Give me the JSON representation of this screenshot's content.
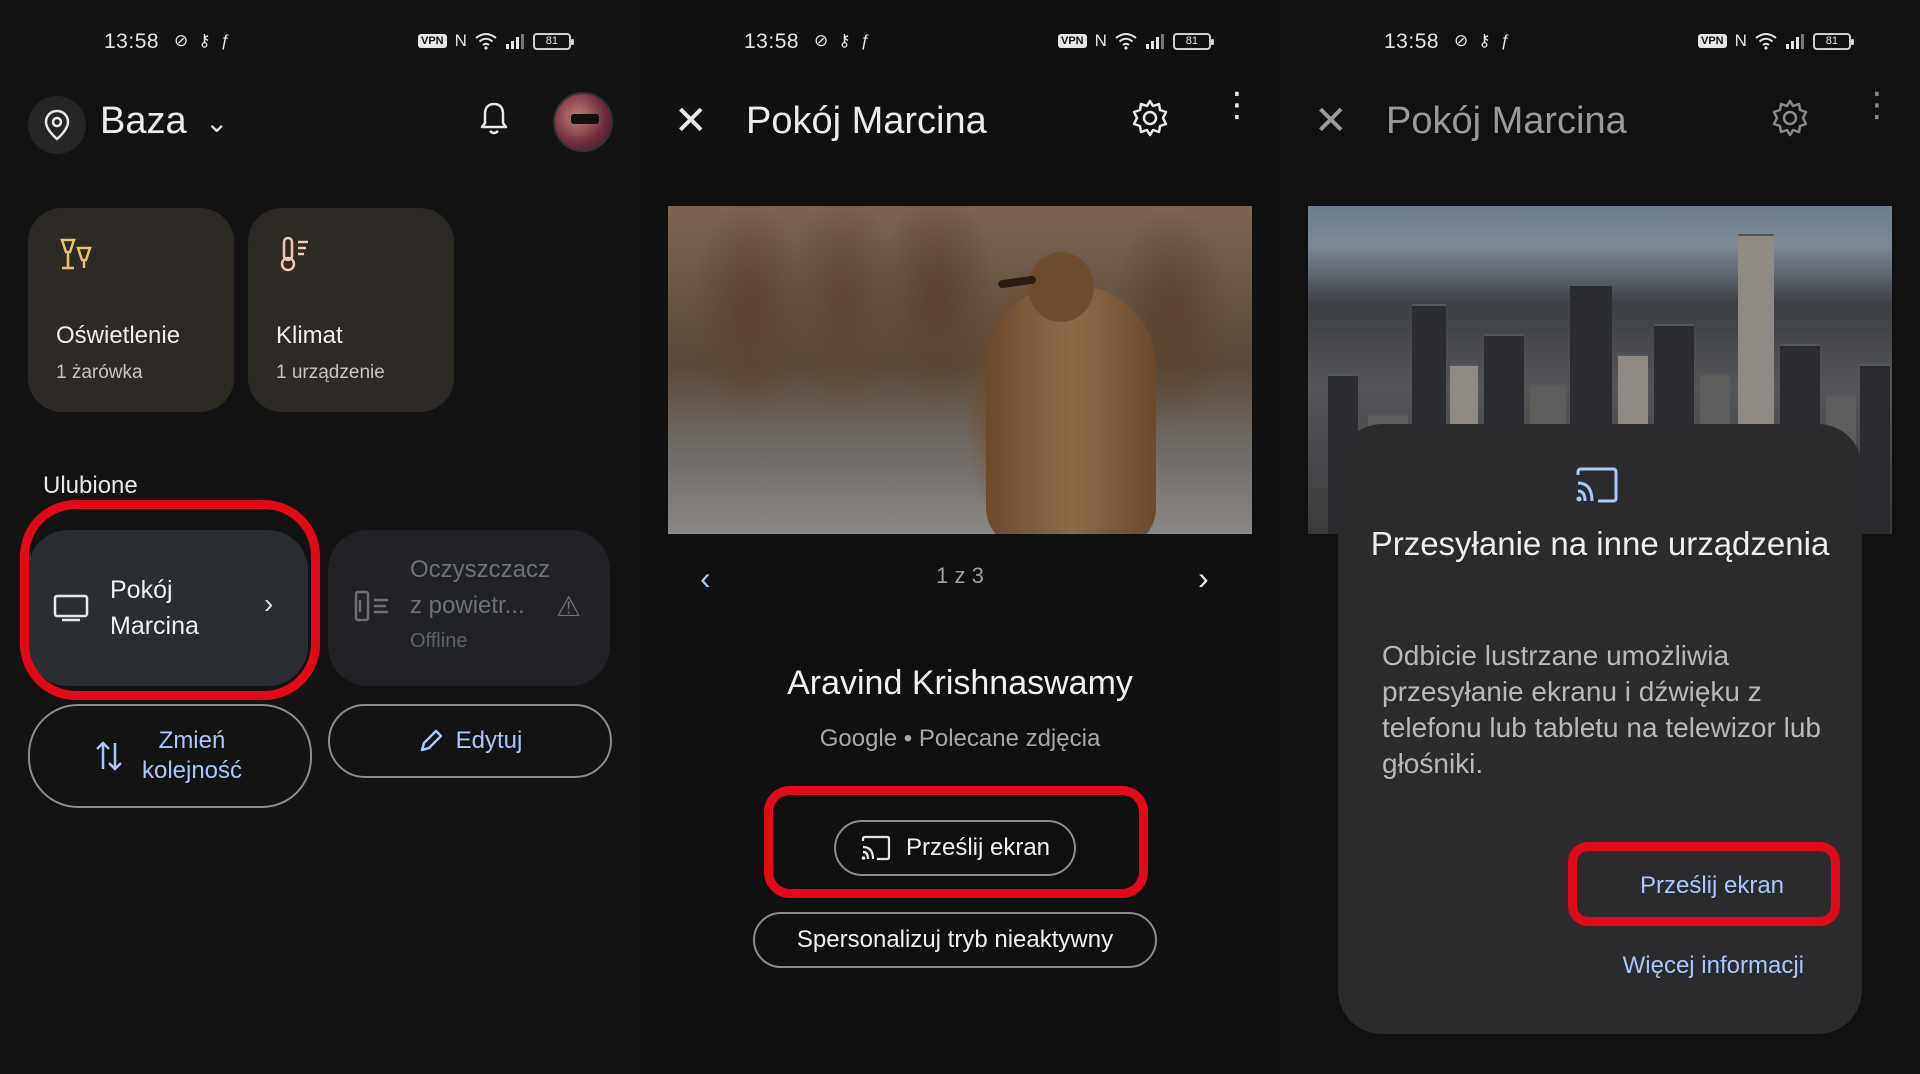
{
  "status_bar": {
    "time": "13:58",
    "vpn": "VPN",
    "nfc": "N",
    "battery": "81"
  },
  "panel1": {
    "home": {
      "name": "Baza"
    },
    "categories": [
      {
        "name": "Oświetlenie",
        "sub": "1 żarówka",
        "icon": "lightbulb-icon"
      },
      {
        "name": "Klimat",
        "sub": "1 urządzenie",
        "icon": "thermostat-icon"
      }
    ],
    "favorites_label": "Ulubione",
    "devices": {
      "room": {
        "name": "Pokój Marcina"
      },
      "purifier": {
        "name": "Oczyszczacz z powietr...",
        "status": "Offline"
      }
    },
    "buttons": {
      "reorder": "Zmień kolejność",
      "edit": "Edytuj"
    }
  },
  "panel2": {
    "title": "Pokój Marcina",
    "pager": "1 z 3",
    "author": "Aravind Krishnaswamy",
    "source": "Google • Polecane zdjęcia",
    "cast_button": "Prześlij ekran",
    "personalize_button": "Spersonalizuj tryb nieaktywny"
  },
  "panel3": {
    "title": "Pokój Marcina",
    "dialog": {
      "title": "Przesyłanie na inne urządzenia",
      "body": "Odbicie lustrzane umożliwia przesyłanie ekranu i dźwięku z telefonu lub tabletu na telewizor lub głośniki.",
      "cast": "Prześlij ekran",
      "more": "Więcej informacji"
    }
  },
  "colors": {
    "accent": "#a8c7fa",
    "highlight": "#e10b17",
    "card": "#2d2a26"
  }
}
